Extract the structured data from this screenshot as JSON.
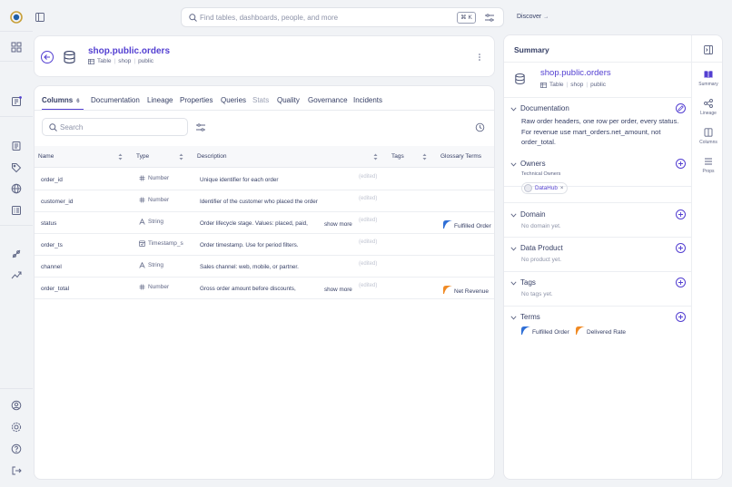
{
  "search": {
    "placeholder": "Find tables, dashboards, people, and more",
    "shortcut": "⌘ K"
  },
  "topbar": {
    "discover_label": "Discover"
  },
  "entity": {
    "name": "shop.public.orders",
    "kind": "Table",
    "path1": "shop",
    "path2": "public"
  },
  "tabs": [
    {
      "label": "Columns",
      "count": "6"
    },
    {
      "label": "Documentation"
    },
    {
      "label": "Lineage"
    },
    {
      "label": "Properties"
    },
    {
      "label": "Queries"
    },
    {
      "label": "Stats"
    },
    {
      "label": "Quality"
    },
    {
      "label": "Governance"
    },
    {
      "label": "Incidents"
    }
  ],
  "table": {
    "search_placeholder": "Search",
    "headers": {
      "name": "Name",
      "type": "Type",
      "description": "Description",
      "tags": "Tags",
      "terms": "Glossary Terms"
    },
    "show_more": "show more",
    "edited": "(edited)",
    "rows": [
      {
        "name": "order_id",
        "type": "Number",
        "type_icon": "hash-icon",
        "description": "Unique identifier for each order",
        "more": false,
        "term": ""
      },
      {
        "name": "customer_id",
        "type": "Number",
        "type_icon": "hash-icon",
        "description": "Identifier of the customer who placed the order",
        "more": false,
        "term": ""
      },
      {
        "name": "status",
        "type": "String",
        "type_icon": "string-icon",
        "description": "Order lifecycle stage. Values: placed, paid,",
        "more": true,
        "term": "Fulfilled Order",
        "term_color": "#2f6fd6"
      },
      {
        "name": "order_ts",
        "type": "Timestamp_s",
        "type_icon": "calendar-icon",
        "description": "Order timestamp. Use for period filters.",
        "more": false,
        "term": ""
      },
      {
        "name": "channel",
        "type": "String",
        "type_icon": "string-icon",
        "description": "Sales channel: web, mobile, or partner.",
        "more": false,
        "term": ""
      },
      {
        "name": "order_total",
        "type": "Number",
        "type_icon": "hash-icon",
        "description": "Gross order amount before discounts,",
        "more": true,
        "term": "Net Revenue",
        "term_color": "#f08a24"
      }
    ]
  },
  "summary": {
    "title": "Summary",
    "documentation": {
      "title": "Documentation",
      "text": "Raw order headers, one row per order, every status. For revenue use mart_orders.net_amount, not order_total."
    },
    "owners": {
      "title": "Owners",
      "group": "Technical Owners",
      "owner": "DataHub"
    },
    "domain": {
      "title": "Domain",
      "empty": "No domain yet."
    },
    "data_product": {
      "title": "Data Product",
      "empty": "No product yet."
    },
    "tags": {
      "title": "Tags",
      "empty": "No tags yet."
    },
    "terms": {
      "title": "Terms",
      "items": [
        "Fulfilled Order",
        "Delivered Rate"
      ]
    }
  },
  "rail": [
    {
      "label": "Summary",
      "icon": "book-icon"
    },
    {
      "label": "Lineage",
      "icon": "lineage-icon"
    },
    {
      "label": "Columns",
      "icon": "columns-icon"
    },
    {
      "label": "Props",
      "icon": "list-icon"
    }
  ],
  "colors": {
    "accent": "#533fd1",
    "term_blue": "#2f6fd6",
    "term_orange": "#f08a24"
  }
}
